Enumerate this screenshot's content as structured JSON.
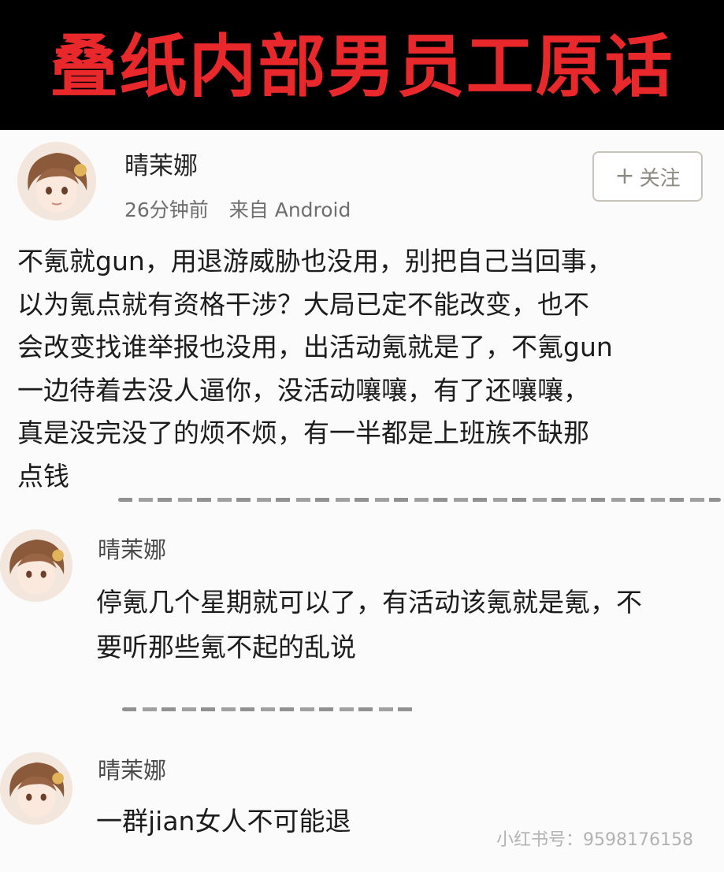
{
  "banner": {
    "title": "叠纸内部男员工原话"
  },
  "post": {
    "username": "晴茉娜",
    "time": "26分钟前",
    "source": "来自 Android",
    "follow_label": "关注",
    "text_lines": [
      "不氪就gun，用退游威胁也没用，别把自己当回事，",
      "以为氪点就有资格干涉？大局已定不能改变，也不",
      "会改变找谁举报也没用，出活动氪就是了，不氪gun",
      "一边待着去没人逼你，没活动嚷嚷，有了还嚷嚷，",
      "真是没完没了的烦不烦，有一半都是上班族不缺那",
      "点钱"
    ]
  },
  "replies": [
    {
      "username": "晴茉娜",
      "text_lines": [
        "停氪几个星期就可以了，有活动该氪就是氪，不",
        "要听那些氪不起的乱说"
      ]
    },
    {
      "username": "晴茉娜",
      "text_lines": [
        "一群jian女人不可能退"
      ]
    }
  ],
  "watermark": {
    "text": "小红书号：9598176158"
  },
  "colors": {
    "banner_bg": "#000000",
    "banner_text": "#e8282b",
    "page_bg": "#fbfbfb"
  }
}
